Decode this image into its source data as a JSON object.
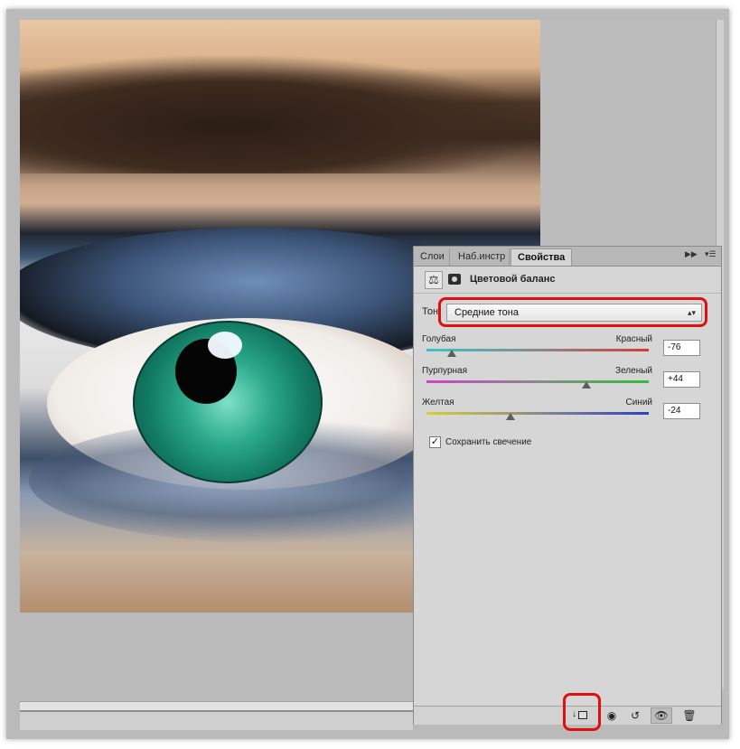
{
  "panel": {
    "tabs": [
      {
        "label": "Слои"
      },
      {
        "label": "Наб.инстр"
      },
      {
        "label": "Свойства",
        "active": true
      }
    ],
    "tabs_overflow_icon": "double-chevron-right-icon",
    "menu_icon": "panel-menu-icon"
  },
  "properties": {
    "adjustment_title": "Цветовой баланс",
    "adjustment_icon": "balance-scale-icon",
    "mask_icon": "layer-mask-icon",
    "tone": {
      "label": "Тон:",
      "selected": "Средние тона"
    },
    "sliders": [
      {
        "left_label": "Голубая",
        "right_label": "Красный",
        "value": "-76",
        "colors": [
          "#38c6c6",
          "#d83a3a"
        ]
      },
      {
        "left_label": "Пурпурная",
        "right_label": "Зеленый",
        "value": "+44",
        "colors": [
          "#cc44cc",
          "#2fbf3a"
        ]
      },
      {
        "left_label": "Желтая",
        "right_label": "Синий",
        "value": "-24",
        "colors": [
          "#d8d02a",
          "#2e3fc4"
        ]
      }
    ],
    "preserve_luminosity": {
      "label": "Сохранить свечение",
      "checked": true
    }
  },
  "bottom_bar": {
    "icons": [
      "clip-to-layer-icon",
      "view-previous-state-icon",
      "reset-icon",
      "visibility-eye-icon",
      "trash-icon"
    ]
  },
  "highlight_color": "#e01010"
}
